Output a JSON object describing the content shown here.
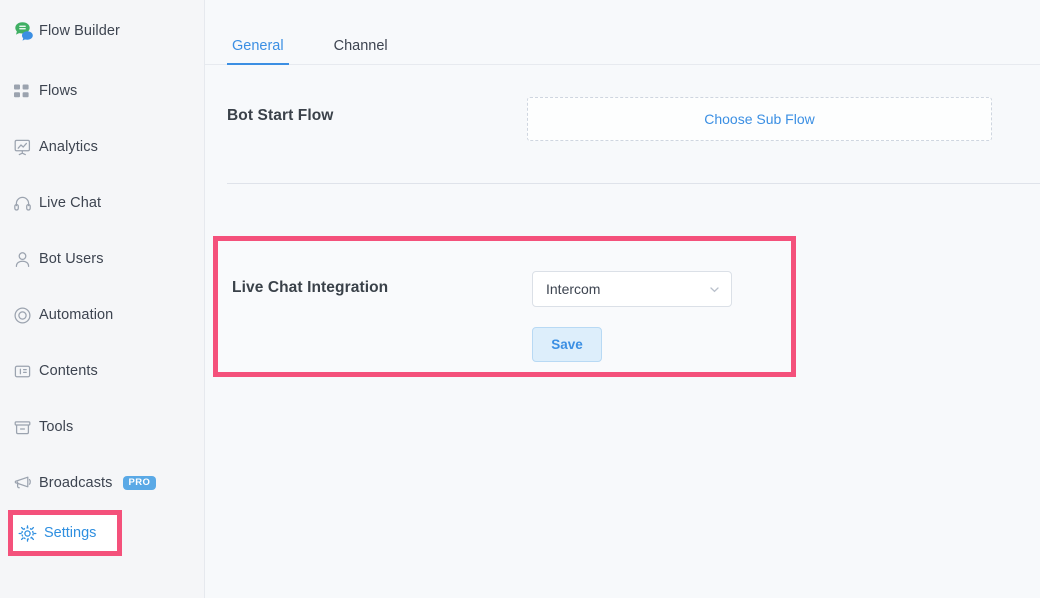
{
  "sidebar": {
    "brand": {
      "label": "Flow Builder",
      "icon": "chat-bubbles-logo-icon"
    },
    "items": [
      {
        "label": "Flows",
        "icon": "grid-squares-icon"
      },
      {
        "label": "Analytics",
        "icon": "presentation-chart-icon"
      },
      {
        "label": "Live Chat",
        "icon": "headset-icon"
      },
      {
        "label": "Bot Users",
        "icon": "user-icon"
      },
      {
        "label": "Automation",
        "icon": "lifebuoy-icon"
      },
      {
        "label": "Contents",
        "icon": "content-layout-icon"
      },
      {
        "label": "Tools",
        "icon": "archive-box-icon"
      },
      {
        "label": "Broadcasts",
        "icon": "megaphone-icon",
        "badge": "PRO"
      }
    ],
    "settings": {
      "label": "Settings",
      "icon": "gear-icon",
      "active": true
    }
  },
  "main": {
    "tabs": [
      {
        "label": "General",
        "active": true
      },
      {
        "label": "Channel",
        "active": false
      }
    ],
    "bot_start_flow": {
      "title": "Bot Start Flow",
      "choose_label": "Choose Sub Flow"
    },
    "live_chat_integration": {
      "title": "Live Chat Integration",
      "selected_option": "Intercom",
      "save_label": "Save",
      "chevron_icon": "chevron-down-icon"
    }
  },
  "colors": {
    "highlight": "#f4517b",
    "accent_blue": "#3b8fe3",
    "badge_blue": "#5aa9e6",
    "sidebar_bg": "#f5f6f8",
    "main_bg": "#f7f9fb",
    "text_dark": "#3d4450"
  }
}
